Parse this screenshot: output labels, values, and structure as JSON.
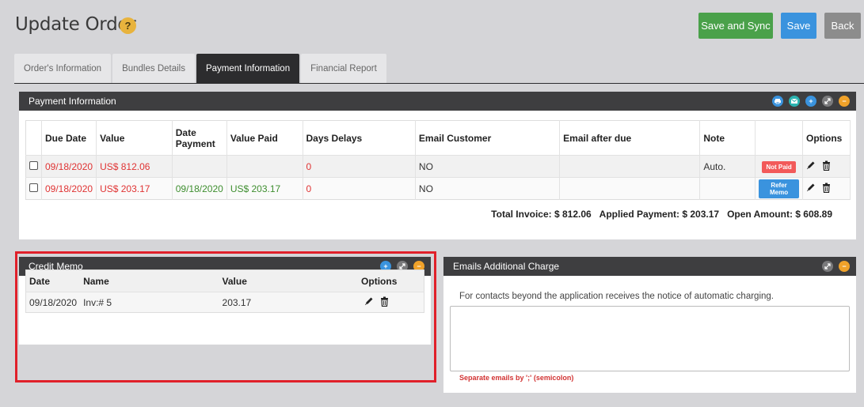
{
  "page": {
    "title": "Update Order",
    "help": "?"
  },
  "header_buttons": {
    "save_sync": "Save and Sync",
    "save": "Save",
    "back": "Back"
  },
  "tabs": [
    {
      "label": "Order's Information",
      "active": false
    },
    {
      "label": "Bundles Details",
      "active": false
    },
    {
      "label": "Payment Information",
      "active": true
    },
    {
      "label": "Financial Report",
      "active": false
    }
  ],
  "payment": {
    "title": "Payment Information",
    "columns": [
      "Due Date",
      "Value",
      "Date Payment",
      "Value Paid",
      "Days Delays",
      "Email Customer",
      "Email after due",
      "Note",
      "",
      "Options"
    ],
    "rows": [
      {
        "due_date": "09/18/2020",
        "value": "US$ 812.06",
        "date_payment": "",
        "value_paid": "",
        "days_delays": "0",
        "email_customer": "NO",
        "email_after_due": "",
        "note": "Auto.",
        "badge": "Not Paid",
        "badge_color": "#f25a5a"
      },
      {
        "due_date": "09/18/2020",
        "value": "US$ 203.17",
        "date_payment": "09/18/2020",
        "value_paid": "US$ 203.17",
        "days_delays": "0",
        "email_customer": "NO",
        "email_after_due": "",
        "note": "",
        "badge": "Refer Memo",
        "badge_color": "#3a93de"
      }
    ],
    "totals": {
      "total_invoice": "Total Invoice: $ 812.06",
      "applied_payment": "Applied Payment: $ 203.17",
      "open_amount": "Open Amount: $ 608.89"
    }
  },
  "credit_memo": {
    "title": "Credit Memo",
    "columns": [
      "Date",
      "Name",
      "Value",
      "Options"
    ],
    "rows": [
      {
        "date": "09/18/2020",
        "name": "Inv:# 5",
        "value": "203.17"
      }
    ]
  },
  "emails_charge": {
    "title": "Emails Additional Charge",
    "description": "For contacts beyond the application receives the notice of automatic charging.",
    "value": "",
    "hint": "Separate emails by ';' (semicolon)"
  },
  "colors": {
    "accent_red": "#e0202a",
    "save_green": "#4aa14a",
    "save_blue": "#3a93de",
    "back_gray": "#8c8c8c",
    "panel_header": "#3e3e40"
  }
}
